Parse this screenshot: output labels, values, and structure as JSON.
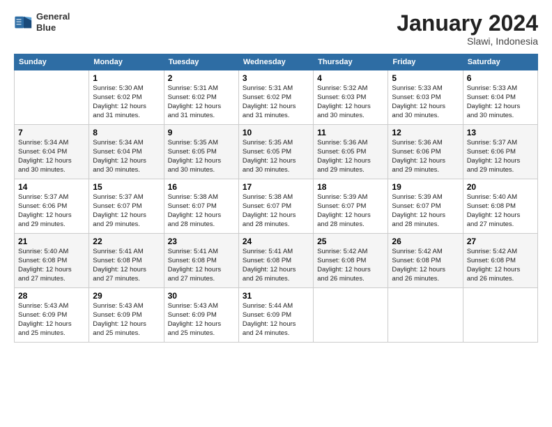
{
  "header": {
    "logo_line1": "General",
    "logo_line2": "Blue",
    "month": "January 2024",
    "location": "Slawi, Indonesia"
  },
  "days_header": [
    "Sunday",
    "Monday",
    "Tuesday",
    "Wednesday",
    "Thursday",
    "Friday",
    "Saturday"
  ],
  "weeks": [
    [
      {
        "day": "",
        "info": ""
      },
      {
        "day": "1",
        "info": "Sunrise: 5:30 AM\nSunset: 6:02 PM\nDaylight: 12 hours\nand 31 minutes."
      },
      {
        "day": "2",
        "info": "Sunrise: 5:31 AM\nSunset: 6:02 PM\nDaylight: 12 hours\nand 31 minutes."
      },
      {
        "day": "3",
        "info": "Sunrise: 5:31 AM\nSunset: 6:02 PM\nDaylight: 12 hours\nand 31 minutes."
      },
      {
        "day": "4",
        "info": "Sunrise: 5:32 AM\nSunset: 6:03 PM\nDaylight: 12 hours\nand 30 minutes."
      },
      {
        "day": "5",
        "info": "Sunrise: 5:33 AM\nSunset: 6:03 PM\nDaylight: 12 hours\nand 30 minutes."
      },
      {
        "day": "6",
        "info": "Sunrise: 5:33 AM\nSunset: 6:04 PM\nDaylight: 12 hours\nand 30 minutes."
      }
    ],
    [
      {
        "day": "7",
        "info": "Sunrise: 5:34 AM\nSunset: 6:04 PM\nDaylight: 12 hours\nand 30 minutes."
      },
      {
        "day": "8",
        "info": "Sunrise: 5:34 AM\nSunset: 6:04 PM\nDaylight: 12 hours\nand 30 minutes."
      },
      {
        "day": "9",
        "info": "Sunrise: 5:35 AM\nSunset: 6:05 PM\nDaylight: 12 hours\nand 30 minutes."
      },
      {
        "day": "10",
        "info": "Sunrise: 5:35 AM\nSunset: 6:05 PM\nDaylight: 12 hours\nand 30 minutes."
      },
      {
        "day": "11",
        "info": "Sunrise: 5:36 AM\nSunset: 6:05 PM\nDaylight: 12 hours\nand 29 minutes."
      },
      {
        "day": "12",
        "info": "Sunrise: 5:36 AM\nSunset: 6:06 PM\nDaylight: 12 hours\nand 29 minutes."
      },
      {
        "day": "13",
        "info": "Sunrise: 5:37 AM\nSunset: 6:06 PM\nDaylight: 12 hours\nand 29 minutes."
      }
    ],
    [
      {
        "day": "14",
        "info": "Sunrise: 5:37 AM\nSunset: 6:06 PM\nDaylight: 12 hours\nand 29 minutes."
      },
      {
        "day": "15",
        "info": "Sunrise: 5:37 AM\nSunset: 6:07 PM\nDaylight: 12 hours\nand 29 minutes."
      },
      {
        "day": "16",
        "info": "Sunrise: 5:38 AM\nSunset: 6:07 PM\nDaylight: 12 hours\nand 28 minutes."
      },
      {
        "day": "17",
        "info": "Sunrise: 5:38 AM\nSunset: 6:07 PM\nDaylight: 12 hours\nand 28 minutes."
      },
      {
        "day": "18",
        "info": "Sunrise: 5:39 AM\nSunset: 6:07 PM\nDaylight: 12 hours\nand 28 minutes."
      },
      {
        "day": "19",
        "info": "Sunrise: 5:39 AM\nSunset: 6:07 PM\nDaylight: 12 hours\nand 28 minutes."
      },
      {
        "day": "20",
        "info": "Sunrise: 5:40 AM\nSunset: 6:08 PM\nDaylight: 12 hours\nand 27 minutes."
      }
    ],
    [
      {
        "day": "21",
        "info": "Sunrise: 5:40 AM\nSunset: 6:08 PM\nDaylight: 12 hours\nand 27 minutes."
      },
      {
        "day": "22",
        "info": "Sunrise: 5:41 AM\nSunset: 6:08 PM\nDaylight: 12 hours\nand 27 minutes."
      },
      {
        "day": "23",
        "info": "Sunrise: 5:41 AM\nSunset: 6:08 PM\nDaylight: 12 hours\nand 27 minutes."
      },
      {
        "day": "24",
        "info": "Sunrise: 5:41 AM\nSunset: 6:08 PM\nDaylight: 12 hours\nand 26 minutes."
      },
      {
        "day": "25",
        "info": "Sunrise: 5:42 AM\nSunset: 6:08 PM\nDaylight: 12 hours\nand 26 minutes."
      },
      {
        "day": "26",
        "info": "Sunrise: 5:42 AM\nSunset: 6:08 PM\nDaylight: 12 hours\nand 26 minutes."
      },
      {
        "day": "27",
        "info": "Sunrise: 5:42 AM\nSunset: 6:08 PM\nDaylight: 12 hours\nand 26 minutes."
      }
    ],
    [
      {
        "day": "28",
        "info": "Sunrise: 5:43 AM\nSunset: 6:09 PM\nDaylight: 12 hours\nand 25 minutes."
      },
      {
        "day": "29",
        "info": "Sunrise: 5:43 AM\nSunset: 6:09 PM\nDaylight: 12 hours\nand 25 minutes."
      },
      {
        "day": "30",
        "info": "Sunrise: 5:43 AM\nSunset: 6:09 PM\nDaylight: 12 hours\nand 25 minutes."
      },
      {
        "day": "31",
        "info": "Sunrise: 5:44 AM\nSunset: 6:09 PM\nDaylight: 12 hours\nand 24 minutes."
      },
      {
        "day": "",
        "info": ""
      },
      {
        "day": "",
        "info": ""
      },
      {
        "day": "",
        "info": ""
      }
    ]
  ]
}
